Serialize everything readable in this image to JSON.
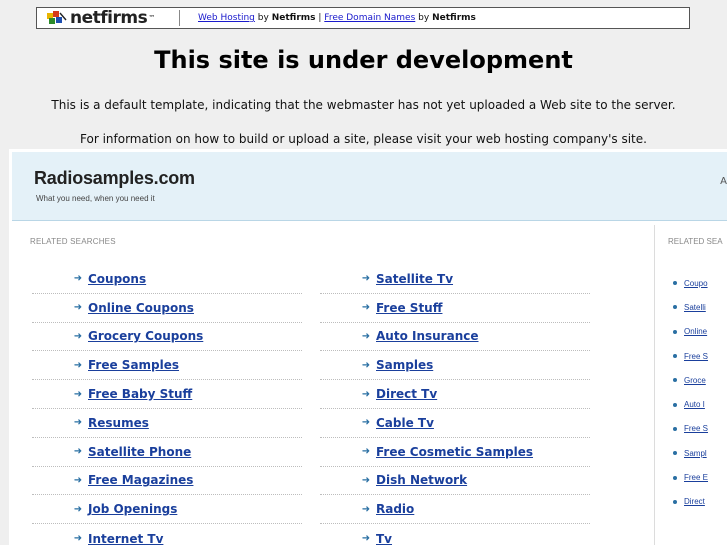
{
  "banner": {
    "logo_text": "netfirms",
    "logo_tm": "™",
    "link1": "Web Hosting",
    "by1": "by",
    "brand1": "Netfirms",
    "divider": "|",
    "link2": "Free Domain Names",
    "by2": "by",
    "brand2": "Netfirms"
  },
  "notice": {
    "headline": "This site is under development",
    "line1": "This is a default template, indicating that the webmaster has not yet uploaded a Web site to the server.",
    "line2": "For information on how to build or upload a site, please visit your web hosting company's site."
  },
  "site": {
    "name": "Radiosamples.com",
    "tagline": "What you need, when you need it",
    "right_mark": "A"
  },
  "related": {
    "heading": "RELATED SEARCHES",
    "col_a": [
      "Coupons",
      "Online Coupons",
      "Grocery Coupons",
      "Free Samples",
      "Free Baby Stuff",
      "Resumes",
      "Satellite Phone",
      "Free Magazines",
      "Job Openings",
      "Internet Tv"
    ],
    "col_b": [
      "Satellite Tv",
      "Free Stuff",
      "Auto Insurance",
      "Samples",
      "Direct Tv",
      "Cable Tv",
      "Free Cosmetic Samples",
      "Dish Network",
      "Radio",
      "Tv"
    ]
  },
  "sidebar": {
    "heading": "RELATED SEA",
    "items": [
      "Coupo",
      "Satelli",
      "Online",
      "Free S",
      "Groce",
      "Auto I",
      "Free S",
      "Sampl",
      "Free E",
      "Direct"
    ]
  },
  "colors": {
    "link": "#1a3f9c",
    "arrow": "#2a6fa3",
    "header_bg": "#e4f1f8",
    "page_bg": "#efefef"
  },
  "icons": {
    "logo": "netfirms-logo-icon",
    "bullet_arrow": "arrow-right-icon",
    "bullet_dot": "dot-icon"
  }
}
